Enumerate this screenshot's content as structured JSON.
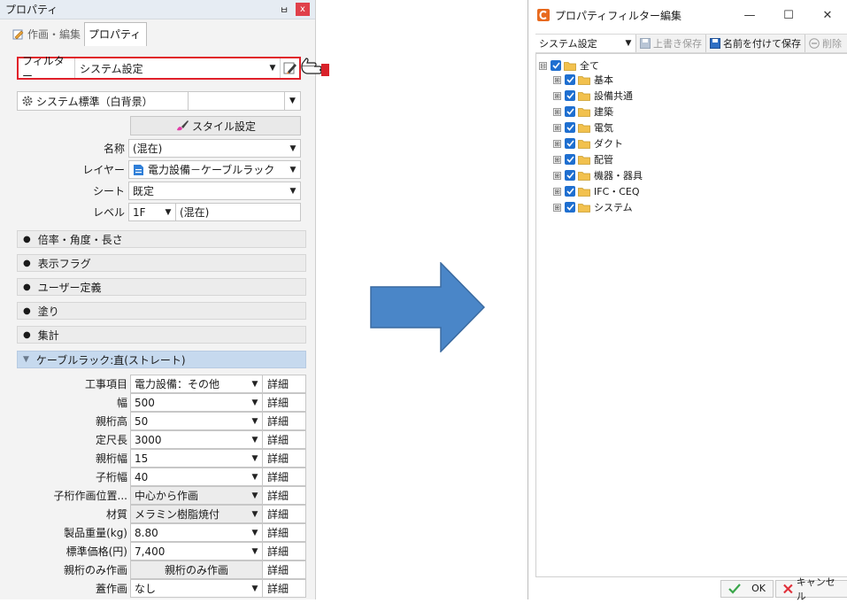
{
  "left_panel": {
    "title": "プロパティ",
    "pin": "ㅂ",
    "close": "x",
    "tabs": [
      {
        "label": "作画・編集"
      },
      {
        "label": "プロパティ"
      }
    ],
    "filter": {
      "label": "フィルター",
      "value": "システム設定"
    },
    "style_profile": {
      "value": "システム標準（白背景）"
    },
    "style_button": "スタイル設定",
    "fields": [
      {
        "key": "名称",
        "value": "(混在)"
      },
      {
        "key": "レイヤー",
        "value": "電力設備－ケーブルラック"
      },
      {
        "key": "シート",
        "value": "既定"
      }
    ],
    "level": {
      "key": "レベル",
      "value": "1F",
      "extra": "(混在)"
    },
    "sections": [
      "倍率・角度・長さ",
      "表示フラグ",
      "ユーザー定義",
      "塗り",
      "集計"
    ],
    "expanded_section": "ケーブルラック:直(ストレート)",
    "detail_label": "詳細",
    "grid": [
      {
        "key": "工事項目",
        "value": "電力設備：その他",
        "dropdown": true,
        "style": "normal"
      },
      {
        "key": "幅",
        "value": "500",
        "dropdown": true,
        "style": "normal"
      },
      {
        "key": "親桁高",
        "value": "50",
        "dropdown": true,
        "style": "normal"
      },
      {
        "key": "定尺長",
        "value": "3000",
        "dropdown": true,
        "style": "normal"
      },
      {
        "key": "親桁幅",
        "value": "15",
        "dropdown": true,
        "style": "normal"
      },
      {
        "key": "子桁幅",
        "value": "40",
        "dropdown": true,
        "style": "normal"
      },
      {
        "key": "子桁作画位置...",
        "value": "中心から作画",
        "dropdown": true,
        "style": "gray"
      },
      {
        "key": "材質",
        "value": "メラミン樹脂焼付",
        "dropdown": true,
        "style": "gray"
      },
      {
        "key": "製品重量(kg)",
        "value": "8.80",
        "dropdown": true,
        "style": "normal"
      },
      {
        "key": "標準価格(円)",
        "value": "7,400",
        "dropdown": true,
        "style": "normal"
      },
      {
        "key": "親桁のみ作画",
        "value": "親桁のみ作画",
        "dropdown": false,
        "style": "button"
      },
      {
        "key": "蓋作画",
        "value": "なし",
        "dropdown": true,
        "style": "normal"
      }
    ]
  },
  "dialog": {
    "title": "プロパティフィルター編集",
    "window_controls": [
      "—",
      "☐",
      "✕"
    ],
    "toolbar": {
      "preset": "システム設定",
      "overwrite": "上書き保存",
      "save_as": "名前を付けて保存",
      "delete": "削除"
    },
    "tree": {
      "root": {
        "label": "全て",
        "toggle": "⊟"
      },
      "children": [
        {
          "label": "基本",
          "toggle": "⊞"
        },
        {
          "label": "設備共通",
          "toggle": "⊞"
        },
        {
          "label": "建築",
          "toggle": "⊞"
        },
        {
          "label": "電気",
          "toggle": "⊞"
        },
        {
          "label": "ダクト",
          "toggle": "⊞"
        },
        {
          "label": "配管",
          "toggle": "⊞"
        },
        {
          "label": "機器・器具",
          "toggle": "⊞"
        },
        {
          "label": "IFC・CEQ",
          "toggle": "⊞"
        },
        {
          "label": "システム",
          "toggle": "⊞"
        }
      ]
    },
    "buttons": {
      "ok": "OK",
      "cancel": "キャンセル"
    }
  },
  "colors": {
    "highlight_border": "#e0202a",
    "section_blue": "#c6d9ee",
    "checkbox_blue": "#1f6fd0",
    "arrow_fill": "#4a86c8",
    "folder": "#f2c14e"
  }
}
